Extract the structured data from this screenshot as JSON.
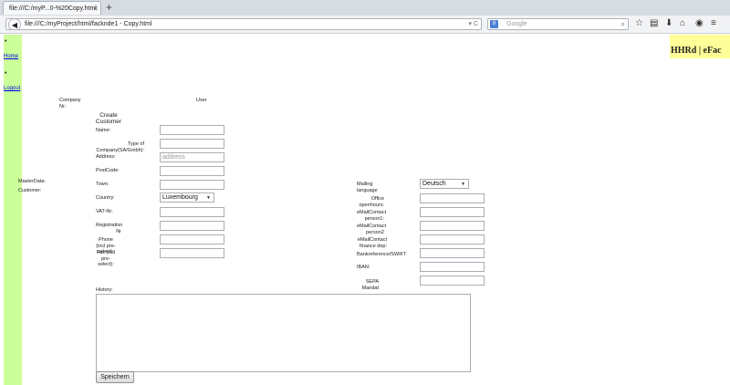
{
  "browser": {
    "tab_title": "file:///C:/myP...0-%20Copy.html",
    "tab_close": "×",
    "new_tab": "+",
    "url": "file:///C:/myProject/html/facknde1 - Copy.html",
    "search_placeholder": "Google",
    "search_engine": "8"
  },
  "nav": {
    "items": [
      {
        "label": "Home"
      },
      {
        "label": "Logout"
      }
    ]
  },
  "brand": "HHRd | eFac",
  "header": {
    "company_nr": "Company Nr:",
    "user": "User"
  },
  "section": {
    "masterdata": "MasterData:",
    "customer": "Customer:",
    "create_customer": "Create Customer"
  },
  "form_left": {
    "name": "Name:",
    "type": "Type of Company(SA/Gmbh):",
    "address": "Address:",
    "address_placeholder": "address",
    "postcode": "PostCode:",
    "town": "Town:",
    "country": "Country:",
    "country_value": "Luxembourg",
    "vat": "VAT-Nr:",
    "registration": "Registration Nr",
    "phone": "Phone (incl pre-select):",
    "fax": "Fax (incl pre-select):"
  },
  "form_right": {
    "mailing_language": "Mailing language",
    "mailing_language_value": "Deutsch",
    "office_hours": "Office openhours:",
    "contact1": "eMailContact person1:",
    "contact2": "eMailContact person2",
    "contact_finance": "eMailContact finance dep:",
    "bank_ref": "Bankreference/SWIFT",
    "iban": "IBAN:",
    "sepa": "SEPA Mandat"
  },
  "history_label": "History:",
  "save_label": "Speichern"
}
